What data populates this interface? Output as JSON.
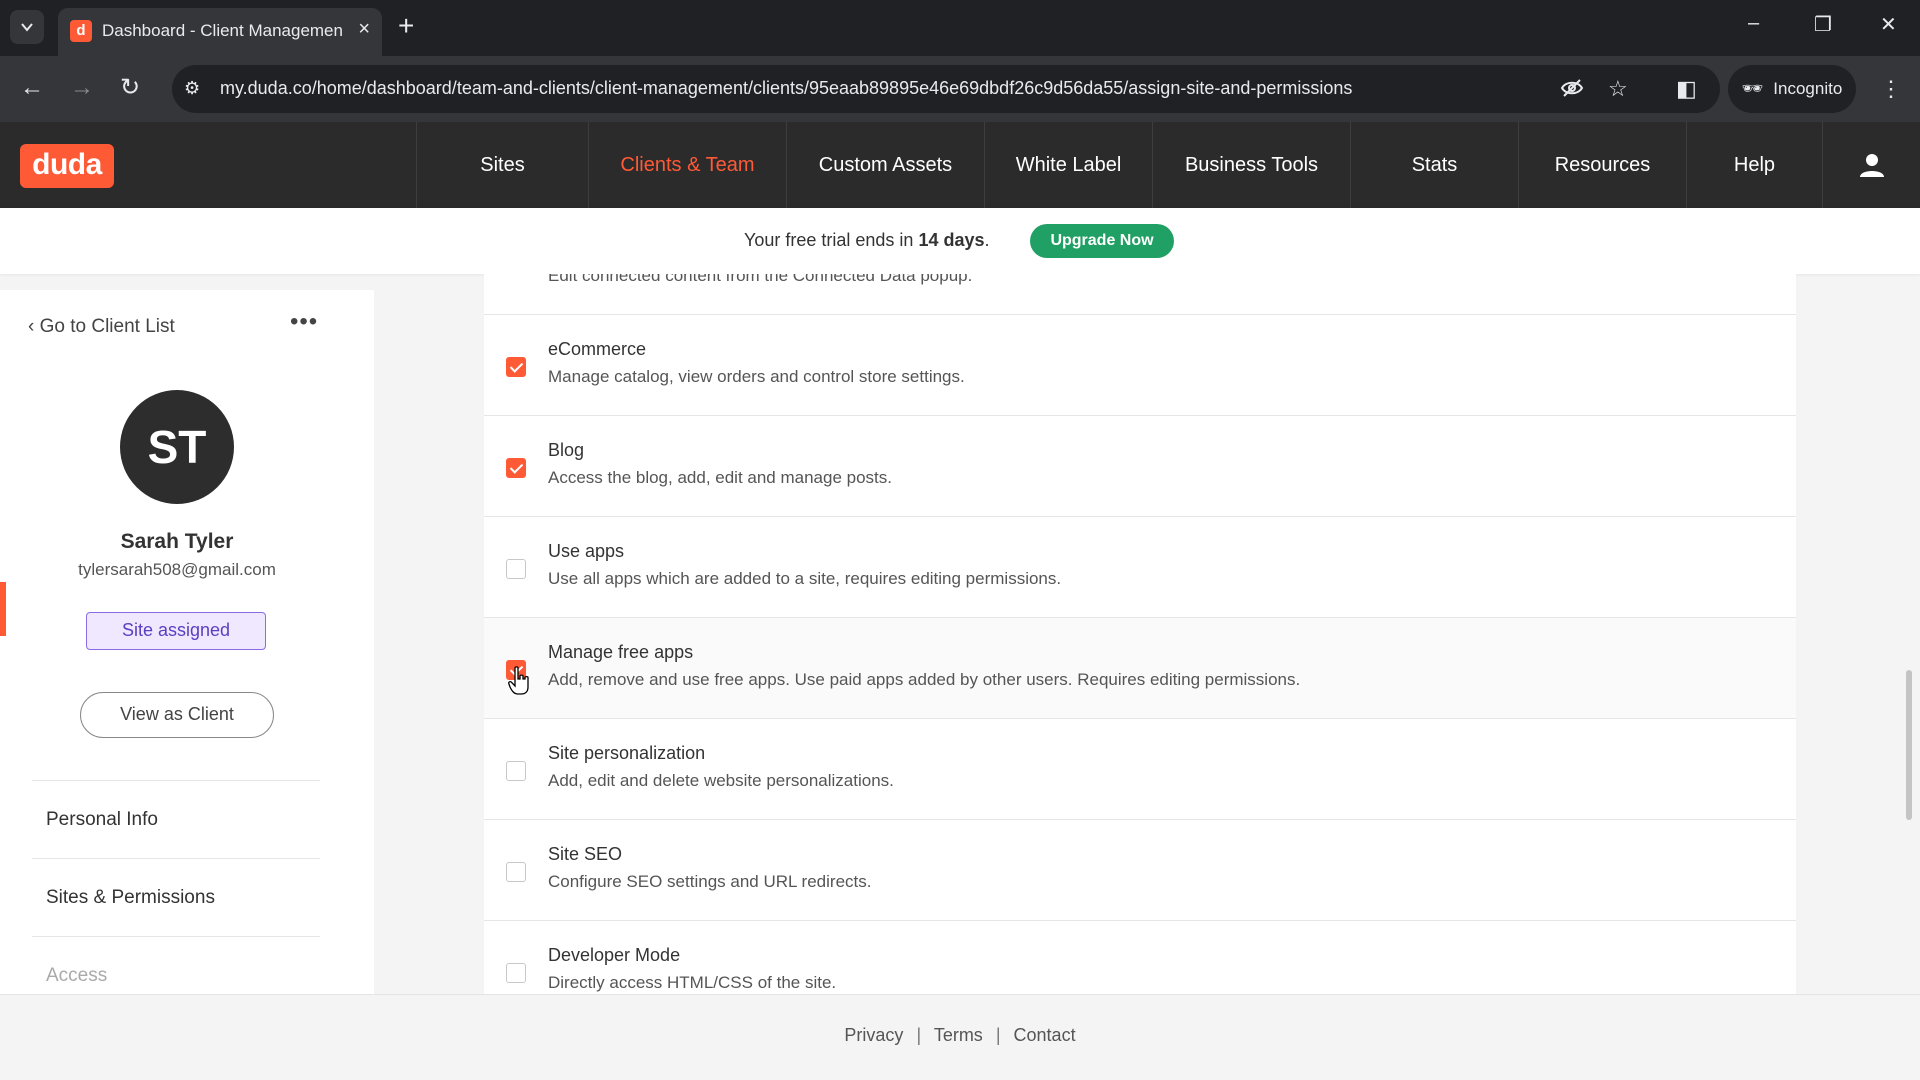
{
  "browser": {
    "tab_title": "Dashboard - Client Managemen",
    "favicon_letter": "d",
    "url": "my.duda.co/home/dashboard/team-and-clients/client-management/clients/95eaab89895e46e69dbdf26c9d56da55/assign-site-and-permissions",
    "incognito_label": "Incognito"
  },
  "app": {
    "logo": "duda",
    "nav": [
      {
        "label": "Sites",
        "active": false
      },
      {
        "label": "Clients & Team",
        "active": true
      },
      {
        "label": "Custom Assets",
        "active": false
      },
      {
        "label": "White Label",
        "active": false
      },
      {
        "label": "Business Tools",
        "active": false
      },
      {
        "label": "Stats",
        "active": false
      },
      {
        "label": "Resources",
        "active": false
      },
      {
        "label": "Help",
        "active": false
      }
    ],
    "accent_color": "#ff5a36"
  },
  "trial": {
    "text_prefix": "Your free trial ends in",
    "days": "14 days",
    "text_suffix": ".",
    "upgrade_label": "Upgrade Now"
  },
  "sidebar": {
    "back_label": "Go to Client List",
    "initials": "ST",
    "name": "Sarah Tyler",
    "email": "tylersarah508@gmail.com",
    "status_badge": "Site assigned",
    "view_as_client": "View as Client",
    "menu": [
      {
        "label": "Personal Info"
      },
      {
        "label": "Sites & Permissions"
      },
      {
        "label": "Access"
      }
    ]
  },
  "permissions": {
    "partial_desc": "Edit connected content from the Connected Data popup.",
    "items": [
      {
        "title": "eCommerce",
        "desc": "Manage catalog, view orders and control store settings.",
        "checked": true
      },
      {
        "title": "Blog",
        "desc": "Access the blog, add, edit and manage posts.",
        "checked": true
      },
      {
        "title": "Use apps",
        "desc": "Use all apps which are added to a site, requires editing permissions.",
        "checked": false
      },
      {
        "title": "Manage free apps",
        "desc": "Add, remove and use free apps. Use paid apps added by other users. Requires editing permissions.",
        "checked": true
      },
      {
        "title": "Site personalization",
        "desc": "Add, edit and delete website personalizations.",
        "checked": false
      },
      {
        "title": "Site SEO",
        "desc": "Configure SEO settings and URL redirects.",
        "checked": false
      },
      {
        "title": "Developer Mode",
        "desc": "Directly access HTML/CSS of the site.",
        "checked": false
      }
    ]
  },
  "footer": {
    "privacy": "Privacy",
    "terms": "Terms",
    "contact": "Contact",
    "separator": "|"
  }
}
